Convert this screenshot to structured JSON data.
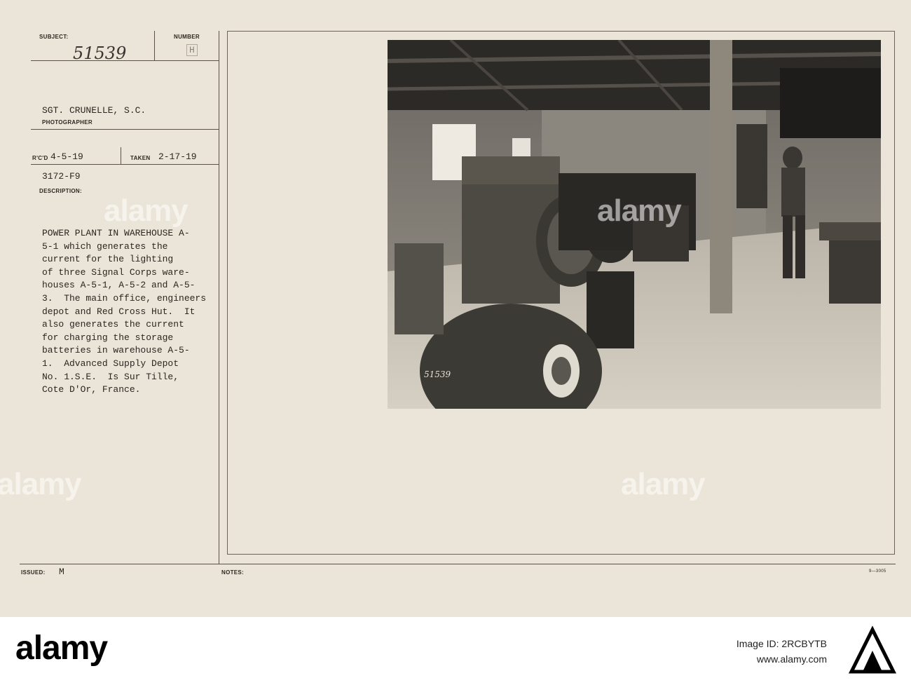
{
  "card": {
    "subject_label": "SUBJECT:",
    "subject_value": "51539",
    "number_label": "NUMBER",
    "number_value": "H",
    "photographer_name": "SGT. CRUNELLE, S.C.",
    "photographer_label": "PHOTOGRAPHER",
    "recd_label": "R'C'D",
    "recd_value": "4-5-19",
    "taken_label": "TAKEN",
    "taken_value": "2-17-19",
    "file_code": "3172-F9",
    "description_label": "DESCRIPTION:",
    "description_lines": [
      "POWER PLANT IN WAREHOUSE A-",
      "5-1 which generates the",
      "current for the lighting",
      "of three Signal Corps ware-",
      "houses A-5-1, A-5-2 and A-5-",
      "3.  The main office, engineers",
      "depot and Red Cross Hut.  It",
      "also generates the current",
      "for charging the storage",
      "batteries in warehouse A-5-",
      "1.  Advanced Supply Depot",
      "No. 1.S.E.  Is Sur Tille,",
      "Cote D'Or, France."
    ],
    "issued_label": "ISSUED:",
    "issued_value": "M",
    "notes_label": "NOTES:",
    "form_code": "9—3005",
    "photo_stamp": "51539"
  },
  "watermarks": [
    "alamy",
    "alamy",
    "alamy",
    "alamy"
  ],
  "footer": {
    "logo": "alamy",
    "image_id_label": "Image ID: 2RCBYTB",
    "url": "www.alamy.com"
  },
  "colors": {
    "card": "#ebe4d8",
    "ink": "#2a2620",
    "rule": "#5a5148"
  }
}
